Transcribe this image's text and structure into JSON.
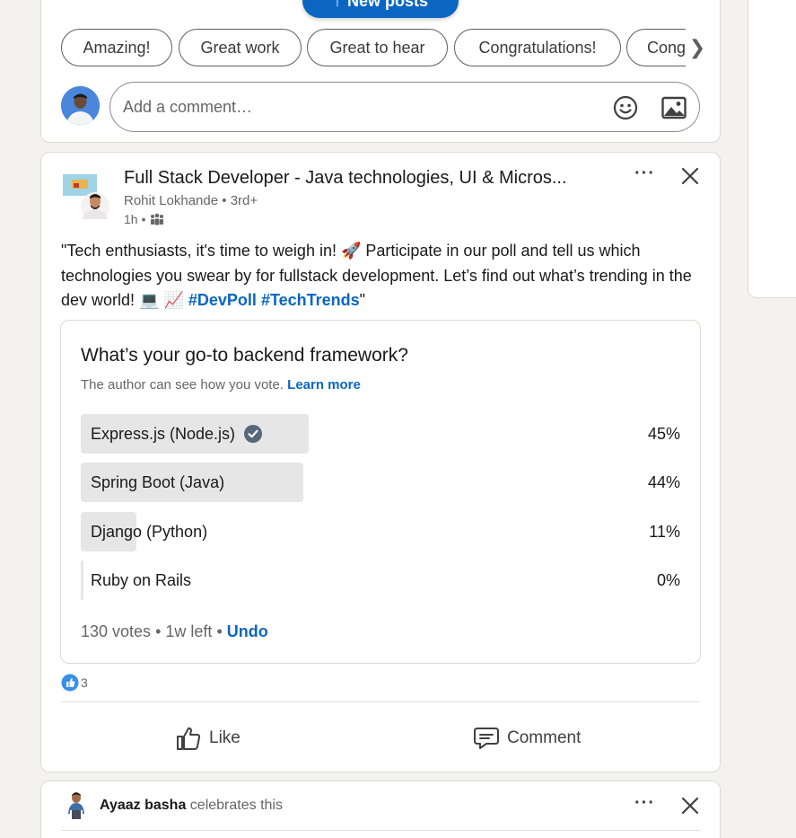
{
  "new_posts_label": "New posts",
  "quick_replies": [
    "Amazing!",
    "Great work",
    "Great to hear",
    "Congratulations!",
    "Cong"
  ],
  "comment": {
    "placeholder": "Add a comment…"
  },
  "post": {
    "title": "Full Stack Developer - Java technologies, UI & Micros...",
    "author": "Rohit Lokhande",
    "degree": "3rd+",
    "time": "1h",
    "text_before": "\"Tech enthusiasts, it's time to weigh in! 🚀 Participate in our poll and tell us which technologies you swear by for fullstack development. Let’s find out what’s trending in the dev world! 💻 📈 ",
    "hashtag1": "#DevPoll",
    "hashtag2": "#TechTrends",
    "text_after": "\"",
    "reaction_count": "3",
    "like_label": "Like",
    "comment_label": "Comment"
  },
  "poll": {
    "question": "What’s your go-to backend framework?",
    "note": "The author can see how you vote.",
    "learn_more": "Learn more",
    "options": [
      {
        "label": "Express.js (Node.js)",
        "percent_text": "45%",
        "percent": 45,
        "selected": true
      },
      {
        "label": "Spring Boot (Java)",
        "percent_text": "44%",
        "percent": 44,
        "selected": false
      },
      {
        "label": "Django (Python)",
        "percent_text": "11%",
        "percent": 11,
        "selected": false
      },
      {
        "label": "Ruby on Rails",
        "percent_text": "0%",
        "percent": 0,
        "selected": false
      }
    ],
    "votes": "130 votes",
    "time_left": "1w left",
    "undo": "Undo"
  },
  "next_post": {
    "name": "Ayaaz basha",
    "action": "celebrates this"
  },
  "colors": {
    "brand": "#0a66c2",
    "poll_fill": "#e6e6e6"
  }
}
